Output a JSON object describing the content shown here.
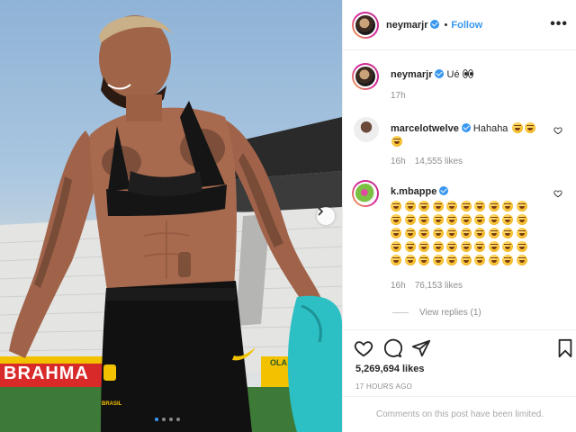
{
  "post": {
    "author": "neymarjr",
    "follow_label": "Follow",
    "more_label": "•••",
    "carousel_dots": 4,
    "carousel_active": 0
  },
  "photo": {
    "banner_text": "BRAHMA",
    "banner_text_2": "OLA",
    "shorts_text": "BRASIL",
    "colors": {
      "sky": "#9bbde0",
      "shorts": "#111111",
      "top": "#151515",
      "shirt": "#2cc0c4",
      "banner": "#d92a2a"
    }
  },
  "comments": [
    {
      "username": "neymarjr",
      "text": "Ué",
      "emoji": "eyes-emoji",
      "time": "17h"
    },
    {
      "username": "marcelotwelve",
      "text": "Hahaha",
      "emoji_count": 3,
      "time": "16h",
      "likes": "14,555 likes"
    },
    {
      "username": "k.mbappe",
      "emoji_count": 50,
      "time": "16h",
      "likes": "76,153 likes",
      "view_replies": "View replies (1)"
    }
  ],
  "actions": {
    "likes": "5,269,694 likes",
    "timestamp": "17 HOURS AGO",
    "limited": "Comments on this post have been limited."
  }
}
